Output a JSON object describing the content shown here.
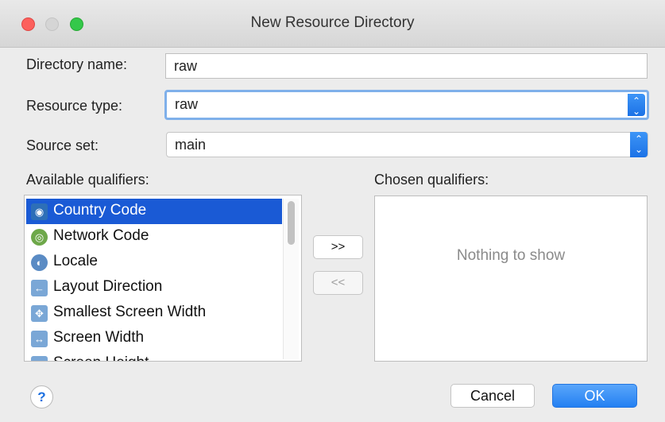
{
  "window": {
    "title": "New Resource Directory"
  },
  "form": {
    "directory_name": {
      "label": "Directory name:",
      "value": "raw"
    },
    "resource_type": {
      "label": "Resource type:",
      "value": "raw"
    },
    "source_set": {
      "label": "Source set:",
      "value": "main"
    }
  },
  "qualifiers": {
    "available_label": "Available qualifiers:",
    "chosen_label": "Chosen qualifiers:",
    "available": [
      {
        "label": "Country Code",
        "icon": "globe-flag-icon",
        "selected": true
      },
      {
        "label": "Network Code",
        "icon": "network-icon",
        "selected": false
      },
      {
        "label": "Locale",
        "icon": "globe-icon",
        "selected": false
      },
      {
        "label": "Layout Direction",
        "icon": "layout-direction-icon",
        "selected": false
      },
      {
        "label": "Smallest Screen Width",
        "icon": "screen-width-icon",
        "selected": false
      },
      {
        "label": "Screen Width",
        "icon": "horizontal-arrows-icon",
        "selected": false
      },
      {
        "label": "Screen Height",
        "icon": "vertical-arrows-icon",
        "selected": false
      }
    ],
    "add_button": ">>",
    "remove_button": "<<",
    "chosen_empty": "Nothing to show"
  },
  "footer": {
    "help": "?",
    "cancel": "Cancel",
    "ok": "OK"
  },
  "colors": {
    "accent": "#1a5ad5",
    "focus": "#7fb0ea",
    "ok_button": "#2380f2"
  }
}
